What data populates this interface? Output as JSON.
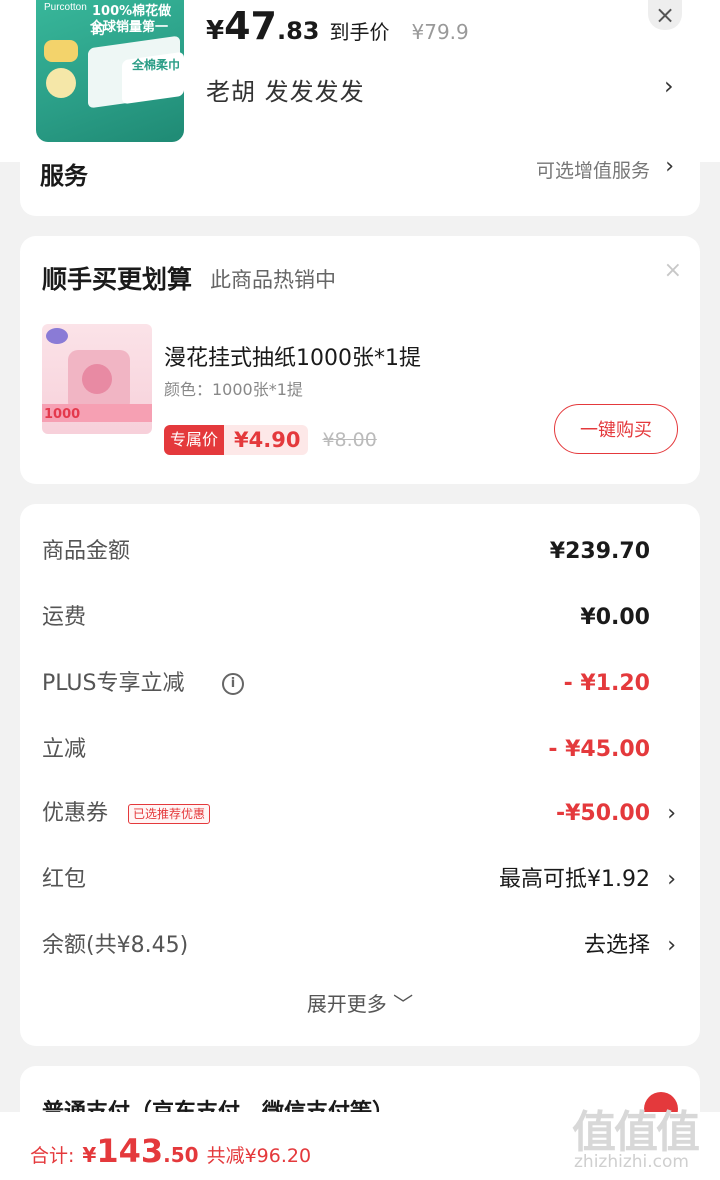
{
  "header": {
    "thumb": {
      "brand": "Purcotton",
      "line1": "100%棉花做的",
      "line2": "全球销量第一",
      "pack_text": "全棉柔巾"
    },
    "price": {
      "yen": "¥",
      "int": "47",
      "dec": ".83",
      "label": "到手价",
      "original": "¥79.9"
    },
    "close": "×",
    "seller": "老胡  发发发发",
    "seller_chevron": "›"
  },
  "service": {
    "title": "服务",
    "value": "可选增值服务",
    "chevron": "›"
  },
  "deal": {
    "title": "顺手买更划算",
    "subtitle": "此商品热销中",
    "close": "×",
    "product": {
      "name": "漫花挂式抽纸1000张*1提",
      "spec": "颜色：1000张*1提",
      "tag": "专属价",
      "price": "¥4.90",
      "original": "¥8.00",
      "img_num": "1000"
    },
    "buy_button": "一键购买"
  },
  "amounts": {
    "rows": [
      {
        "label": "商品金额",
        "value": "¥239.70"
      },
      {
        "label": "运费",
        "value": "¥0.00"
      },
      {
        "label": "PLUS专享立减",
        "value": "- ¥1.20",
        "info": "i"
      },
      {
        "label": "立减",
        "value": "- ¥45.00"
      },
      {
        "label": "优惠券",
        "value": "-¥50.00",
        "tag": "已选推荐优惠",
        "chevron": "›"
      },
      {
        "label": "红包",
        "value": "最高可抵¥1.92",
        "chevron": "›"
      },
      {
        "label": "余额(共¥8.45)",
        "value": "去选择",
        "chevron": "›"
      }
    ],
    "expand": "展开更多 ﹀"
  },
  "payment": {
    "title": "普通支付（京东支付、微信支付等）"
  },
  "bottom": {
    "label": "合计:",
    "yen": "¥",
    "int": "143",
    "dec": ".50",
    "saved": "共减¥96.20"
  },
  "watermark": {
    "top": "值值值",
    "bottom": "zhizhizhi.com"
  },
  "colors": {
    "accent": "#e4393c",
    "teal": "#2a9d86"
  }
}
